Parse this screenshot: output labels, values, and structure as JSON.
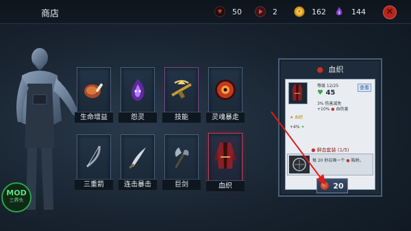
{
  "header": {
    "title": "商店",
    "resources": [
      {
        "icon": "demon-emblem-icon",
        "value": "50",
        "color": "#c23a2a"
      },
      {
        "icon": "red-play-gem-icon",
        "value": "2",
        "color": "#d23b33"
      },
      {
        "icon": "gold-coin-icon",
        "value": "162",
        "color": "#e3a024"
      },
      {
        "icon": "purple-soul-flame-icon",
        "value": "144",
        "color": "#9b4fe0"
      }
    ],
    "close_icon": "close-x-icon"
  },
  "items": [
    {
      "label": "生命增益",
      "icon": "meat-leg-icon"
    },
    {
      "label": "怨灵",
      "icon": "purple-ghost-flame-icon"
    },
    {
      "label": "技能",
      "icon": "golden-crossbow-icon"
    },
    {
      "label": "灵魂暴走",
      "icon": "red-eye-orb-icon"
    },
    {
      "label": "三重箭",
      "icon": "bow-icon"
    },
    {
      "label": "连击暴击",
      "icon": "scimitar-icon"
    },
    {
      "label": "巨剑",
      "icon": "battle-axe-icon"
    },
    {
      "label": "血织",
      "icon": "crimson-robe-icon"
    }
  ],
  "detail": {
    "title": "血织",
    "title_icon": "blood-drop-icon",
    "level": "等级 12/25",
    "view": "查看",
    "stat_value": "45",
    "line1": "3% 伤害减免",
    "line2": "+10%",
    "line2b": "血伤害",
    "bonus1": "★ 血织",
    "bonus2": "+4%",
    "set_name": "鲜血套装 (1/5)",
    "desc": "每 20 秒召唤一个",
    "desc_tail": "陷阱。",
    "price": "20"
  },
  "watermark": {
    "line1": "MOD",
    "line2": "三界头"
  }
}
